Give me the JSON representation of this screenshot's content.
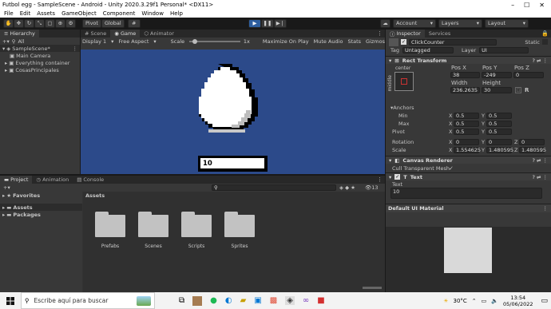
{
  "window": {
    "title": "Futbol egg - SampleScene - Android - Unity 2020.3.29f1 Personal* <DX11>"
  },
  "menu": [
    "File",
    "Edit",
    "Assets",
    "GameObject",
    "Component",
    "Window",
    "Help"
  ],
  "toolbar": {
    "pivot": "Pivot",
    "global": "Global",
    "account": "Account",
    "layers": "Layers",
    "layout": "Layout"
  },
  "hierarchy": {
    "tab": "Hierarchy",
    "search_prefix": "All",
    "items": [
      "SampleScene*",
      "Main Camera",
      "Everything container",
      "CosasPrincipales"
    ]
  },
  "scene_tabs": [
    "Scene",
    "Game",
    "Animator"
  ],
  "game_bar": {
    "display": "Display 1",
    "aspect": "Free Aspect",
    "scale_label": "Scale",
    "scale_value": "1x",
    "maximize": "Maximize On Play",
    "mute": "Mute Audio",
    "stats": "Stats",
    "gizmos": "Gizmos"
  },
  "game_view": {
    "counter_text": "10"
  },
  "project": {
    "tabs": [
      "Project",
      "Animation",
      "Console"
    ],
    "sidebar": [
      "Favorites",
      "Assets",
      "Packages"
    ],
    "breadcrumb": "Assets",
    "folders": [
      "Prefabs",
      "Scenes",
      "Scripts",
      "Sprites"
    ],
    "count": "13"
  },
  "inspector": {
    "tabs": [
      "Inspector",
      "Services"
    ],
    "object_name": "ClickCounter",
    "static_label": "Static",
    "tag_label": "Tag",
    "tag_value": "Untagged",
    "layer_label": "Layer",
    "layer_value": "UI",
    "rect_transform": {
      "title": "Rect Transform",
      "anchor_h": "center",
      "anchor_v": "middle",
      "pos_labels": [
        "Pos X",
        "Pos Y",
        "Pos Z"
      ],
      "pos_values": [
        "38",
        "-249",
        "0"
      ],
      "width_label": "Width",
      "height_label": "Height",
      "width": "236.2635",
      "height": "30",
      "anchors_label": "Anchors",
      "min_label": "Min",
      "min_x": "0.5",
      "min_y": "0.5",
      "max_label": "Max",
      "max_x": "0.5",
      "max_y": "0.5",
      "pivot_label": "Pivot",
      "pivot_x": "0.5",
      "pivot_y": "0.5",
      "rotation_label": "Rotation",
      "rot_x": "0",
      "rot_y": "0",
      "rot_z": "0",
      "scale_label": "Scale",
      "scale_x": "1.554625",
      "scale_y": "1.480595",
      "scale_z": "1.480595"
    },
    "canvas_renderer": {
      "title": "Canvas Renderer",
      "cull_label": "Cull Transparent Mesh"
    },
    "text": {
      "title": "Text",
      "field_label": "Text",
      "value": "10"
    },
    "material": "Default UI Material"
  },
  "taskbar": {
    "search_placeholder": "Escribe aquí para buscar",
    "temperature": "30°C",
    "time": "13:54",
    "date": "05/06/2022"
  }
}
